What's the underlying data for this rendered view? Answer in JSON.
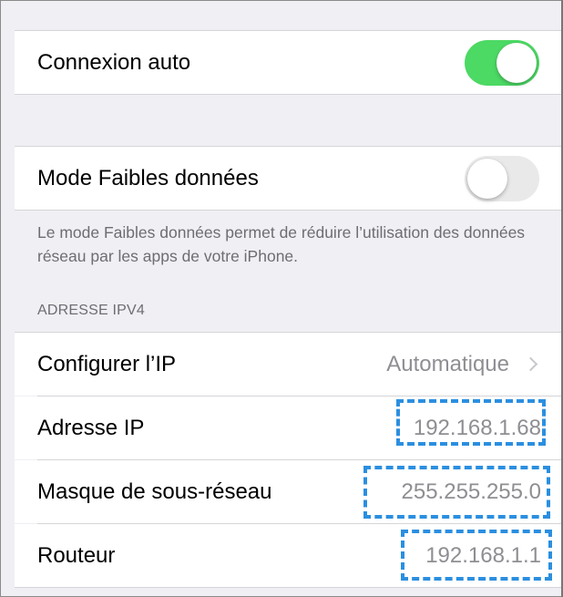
{
  "rows": {
    "auto_join": {
      "label": "Connexion auto",
      "toggle": "on"
    },
    "low_data": {
      "label": "Mode Faibles données",
      "toggle": "off"
    },
    "configure_ip": {
      "label": "Configurer l’IP",
      "value": "Automatique"
    },
    "ip_address": {
      "label": "Adresse IP",
      "value": "192.168.1.68"
    },
    "subnet_mask": {
      "label": "Masque de sous-réseau",
      "value": "255.255.255.0"
    },
    "router": {
      "label": "Routeur",
      "value": "192.168.1.1"
    }
  },
  "low_data_footer": "Le mode Faibles données permet de réduire l’utilisation des données réseau par les apps de votre iPhone.",
  "ipv4_header": "ADRESSE IPV4",
  "icons": {
    "chevron": "chevron-right-icon"
  },
  "colors": {
    "toggle_on": "#4cd964",
    "toggle_off": "#e9e9ea",
    "highlight": "#2b8fe0",
    "secondary_text": "#8e8e93",
    "group_background": "#efeff4"
  }
}
